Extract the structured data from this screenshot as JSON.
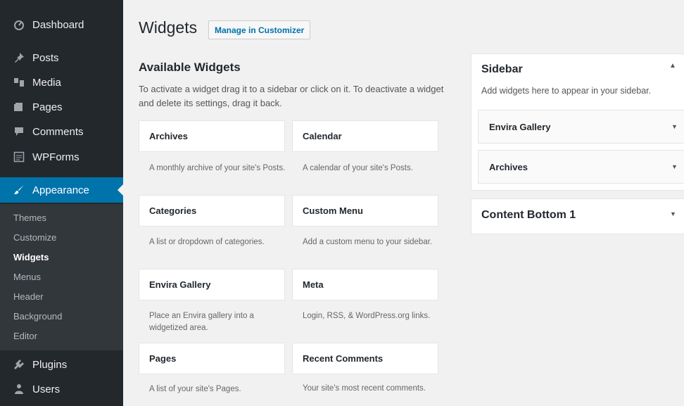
{
  "admin_menu": {
    "items": [
      {
        "label": "Dashboard",
        "icon": "dashboard-icon"
      },
      {
        "label": "Posts",
        "icon": "pin-icon"
      },
      {
        "label": "Media",
        "icon": "media-icon"
      },
      {
        "label": "Pages",
        "icon": "pages-icon"
      },
      {
        "label": "Comments",
        "icon": "comment-icon"
      },
      {
        "label": "WPForms",
        "icon": "form-icon"
      },
      {
        "label": "Appearance",
        "icon": "brush-icon"
      },
      {
        "label": "Plugins",
        "icon": "plugin-icon"
      },
      {
        "label": "Users",
        "icon": "users-icon"
      }
    ],
    "submenu": [
      "Themes",
      "Customize",
      "Widgets",
      "Menus",
      "Header",
      "Background",
      "Editor"
    ],
    "accent_color": "#0073aa"
  },
  "page": {
    "title": "Widgets",
    "customizer_button": "Manage in Customizer"
  },
  "available": {
    "title": "Available Widgets",
    "description": "To activate a widget drag it to a sidebar or click on it. To deactivate a widget and delete its settings, drag it back.",
    "widgets": [
      {
        "name": "Archives",
        "description": "A monthly archive of your site's Posts."
      },
      {
        "name": "Calendar",
        "description": "A calendar of your site's Posts."
      },
      {
        "name": "Categories",
        "description": "A list or dropdown of categories."
      },
      {
        "name": "Custom Menu",
        "description": "Add a custom menu to your sidebar."
      },
      {
        "name": "Envira Gallery",
        "description": "Place an Envira gallery into a widgetized area."
      },
      {
        "name": "Meta",
        "description": "Login, RSS, & WordPress.org links."
      },
      {
        "name": "Pages",
        "description": "A list of your site's Pages."
      },
      {
        "name": "Recent Comments",
        "description": "Your site's most recent comments."
      }
    ]
  },
  "sidebar": {
    "title": "Sidebar",
    "description": "Add widgets here to appear in your sidebar.",
    "widgets": [
      "Envira Gallery",
      "Archives"
    ]
  },
  "content_bottom": {
    "title": "Content Bottom 1"
  }
}
